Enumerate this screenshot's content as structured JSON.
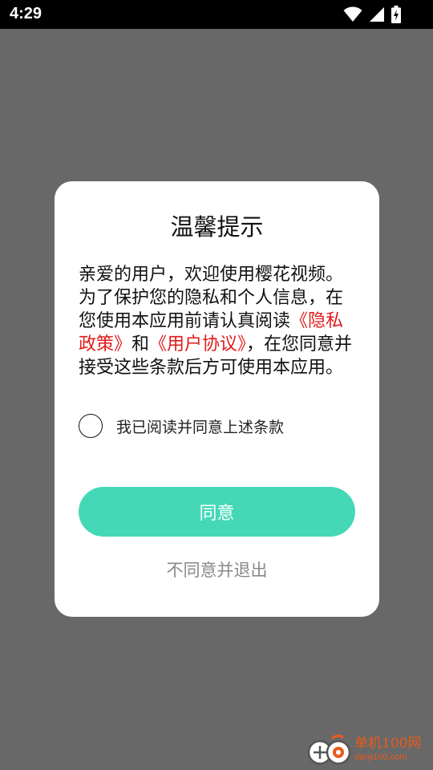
{
  "status_bar": {
    "time": "4:29",
    "icons": [
      "wifi-icon",
      "signal-icon",
      "battery-charging-icon"
    ]
  },
  "dialog": {
    "title": "温馨提示",
    "message_part1": "亲爱的用户，欢迎使用樱花视频。为了保护您的隐私和个人信息，在您使用本应用前请认真阅读",
    "privacy_link": "《隐私政策》",
    "message_part2": "和",
    "user_agreement_link": "《用户协议》",
    "message_part3": "，在您同意并接受这些条款后方可使用本应用。",
    "consent_label": "我已阅读并同意上述条款",
    "consent_checked": false,
    "agree_button": "同意",
    "disagree_link": "不同意并退出"
  },
  "watermark": {
    "name": "单机100网",
    "domain": "danji100.com"
  },
  "colors": {
    "accent": "#44d8b7",
    "link": "#e21a1a",
    "overlay": "#686868",
    "watermark": "#e85a1b"
  }
}
